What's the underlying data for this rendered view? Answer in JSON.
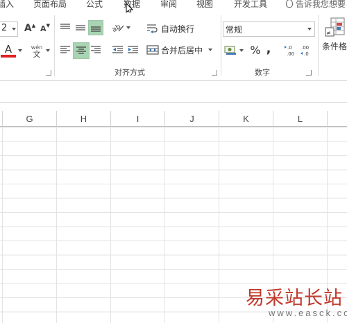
{
  "tabs": [
    "插入",
    "页面布局",
    "公式",
    "数据",
    "审阅",
    "视图",
    "开发工具"
  ],
  "tell_me": "告诉我您想要",
  "font": {
    "size_value": "2",
    "grow_label": "A",
    "shrink_label": "A",
    "font_color_label": "A",
    "pinyin_top": "wén",
    "pinyin_bottom": "文"
  },
  "alignment": {
    "wrap_text": "自动换行",
    "merge_center": "合并后居中",
    "group_label": "对齐方式"
  },
  "number": {
    "format_value": "常规",
    "percent": "%",
    "comma": ",",
    "increase_decimal": "+.0\n.00",
    "decrease_decimal": ".00\n→.0",
    "group_label": "数字"
  },
  "styles": {
    "conditional_format": "条件格"
  },
  "columns": [
    "G",
    "H",
    "I",
    "J",
    "K",
    "L"
  ],
  "watermark": {
    "text": "易采站长站",
    "sub": "www.easck.com"
  },
  "colors": {
    "selected": "#a9d4b3",
    "font_red": "#e02020",
    "watermark": "#c0392b"
  }
}
